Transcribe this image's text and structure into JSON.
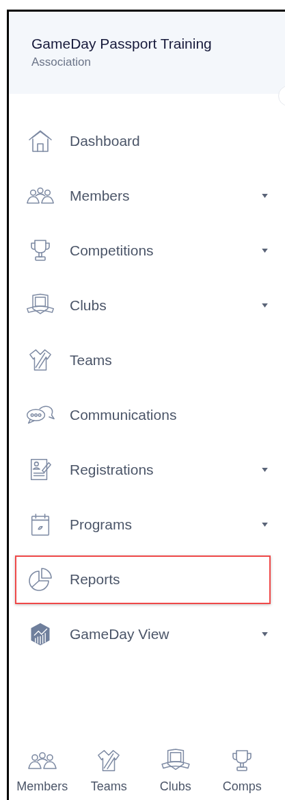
{
  "header": {
    "title": "GameDay Passport Training",
    "subtitle": "Association"
  },
  "menu": [
    {
      "label": "Dashboard",
      "has_submenu": false,
      "highlighted": false
    },
    {
      "label": "Members",
      "has_submenu": true,
      "highlighted": false
    },
    {
      "label": "Competitions",
      "has_submenu": true,
      "highlighted": false
    },
    {
      "label": "Clubs",
      "has_submenu": true,
      "highlighted": false
    },
    {
      "label": "Teams",
      "has_submenu": false,
      "highlighted": false
    },
    {
      "label": "Communications",
      "has_submenu": false,
      "highlighted": false
    },
    {
      "label": "Registrations",
      "has_submenu": true,
      "highlighted": false
    },
    {
      "label": "Programs",
      "has_submenu": true,
      "highlighted": false
    },
    {
      "label": "Reports",
      "has_submenu": false,
      "highlighted": true
    },
    {
      "label": "GameDay View",
      "has_submenu": true,
      "highlighted": false
    }
  ],
  "bottom_nav": [
    {
      "label": "Members"
    },
    {
      "label": "Teams"
    },
    {
      "label": "Clubs"
    },
    {
      "label": "Comps"
    }
  ]
}
